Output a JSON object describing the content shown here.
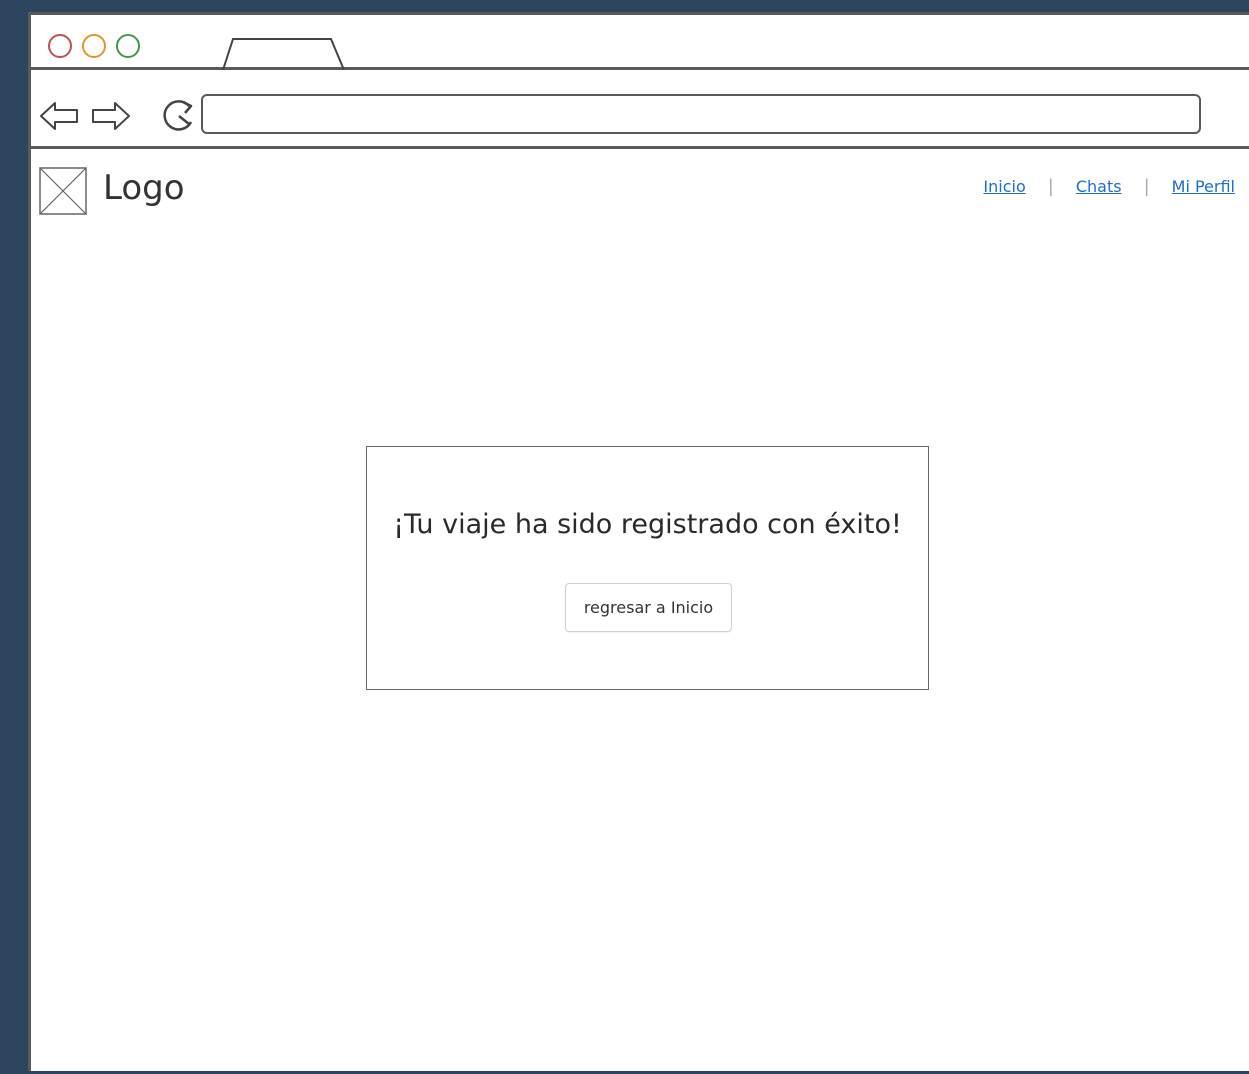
{
  "header": {
    "logo_text": "Logo",
    "nav": [
      {
        "label": "Inicio"
      },
      {
        "label": "Chats"
      },
      {
        "label": "Mi Perfil"
      }
    ],
    "link_color": "#1a6fd1"
  },
  "dialog": {
    "message": "¡Tu viaje ha sido registrado con éxito!",
    "button_label": "regresar a Inicio"
  },
  "browser": {
    "url": "",
    "traffic_light_colors": [
      "#c0504d",
      "#e3952b",
      "#3f9b45"
    ],
    "background_color": "#2e4560"
  }
}
